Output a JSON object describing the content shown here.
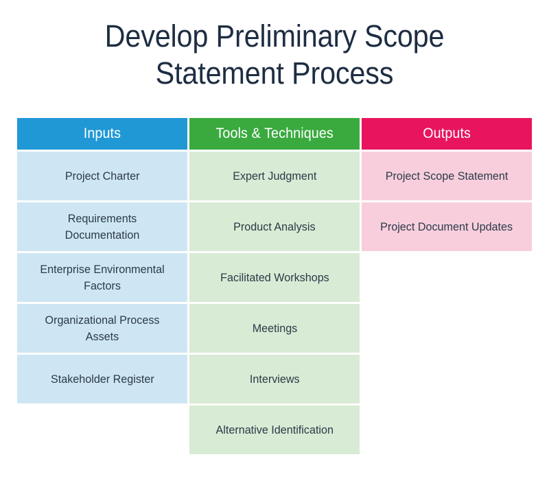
{
  "page": {
    "background_color": "#ffffff"
  },
  "title": {
    "full": "Develop Preliminary Scope Statement Process",
    "line1": "Develop Preliminary Scope",
    "line2": "Statement Process",
    "color": "#1e2d42"
  },
  "matrix": {
    "columns": [
      {
        "key": "inputs",
        "header": "Inputs",
        "header_color": "#2098d6",
        "cell_color": "#cee6f4",
        "text_color": "#2b3a48",
        "items": [
          "Project Charter",
          "Requirements Documentation",
          "Enterprise Environmental Factors",
          "Organizational Process Assets",
          "Stakeholder Register"
        ]
      },
      {
        "key": "tools",
        "header": "Tools & Techniques",
        "header_color": "#3aaa3f",
        "cell_color": "#d8ebd4",
        "text_color": "#2b3a48",
        "items": [
          "Expert Judgment",
          "Product Analysis",
          "Facilitated Workshops",
          "Meetings",
          "Interviews",
          "Alternative Identification"
        ]
      },
      {
        "key": "outputs",
        "header": "Outputs",
        "header_color": "#e8155e",
        "cell_color": "#f8cedd",
        "text_color": "#2b3a48",
        "items": [
          "Project Scope Statement",
          "Project Document Updates"
        ]
      }
    ]
  }
}
